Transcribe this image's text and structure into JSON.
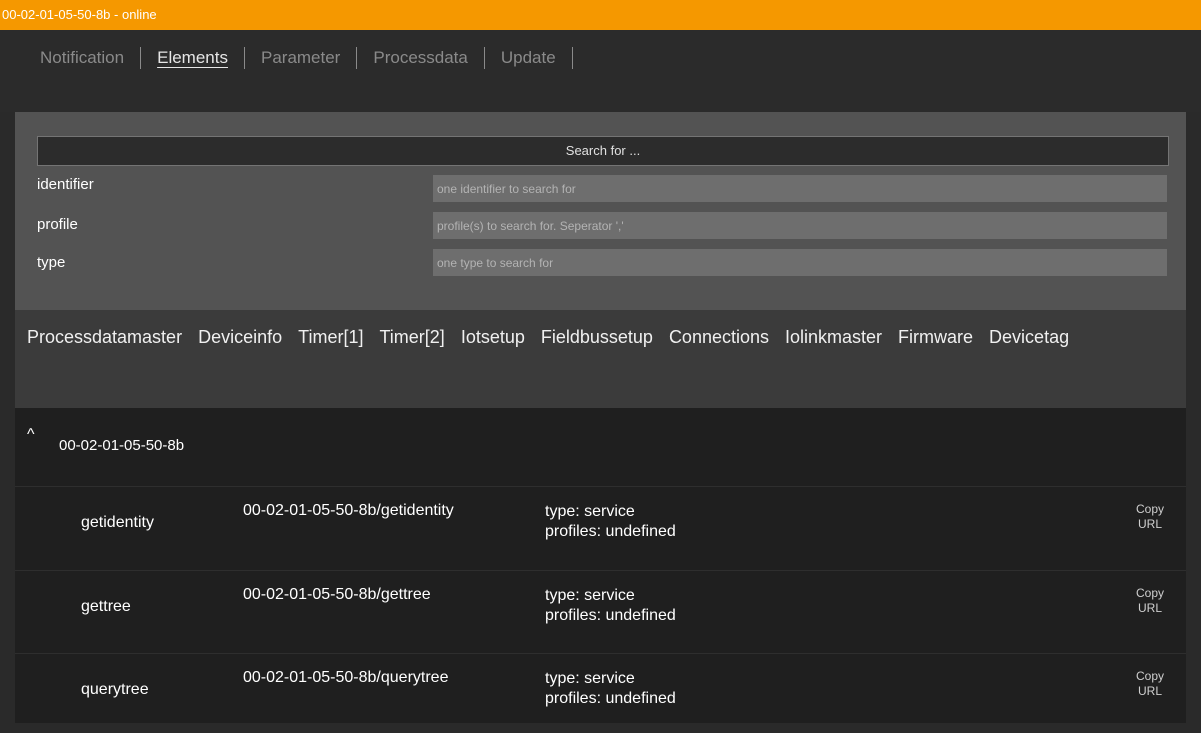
{
  "window": {
    "title": "00-02-01-05-50-8b - online"
  },
  "tabs": [
    {
      "label": "Notification"
    },
    {
      "label": "Elements"
    },
    {
      "label": "Parameter"
    },
    {
      "label": "Processdata"
    },
    {
      "label": "Update"
    }
  ],
  "active_tab": "Elements",
  "search": {
    "heading": "Search for ...",
    "fields": [
      {
        "label": "identifier",
        "placeholder": "one identifier to search for"
      },
      {
        "label": "profile",
        "placeholder": "profile(s) to search for. Seperator ','"
      },
      {
        "label": "type",
        "placeholder": "one type to search for"
      }
    ]
  },
  "categories": [
    "Processdatamaster",
    "Deviceinfo",
    "Timer[1]",
    "Timer[2]",
    "Iotsetup",
    "Fieldbussetup",
    "Connections",
    "Iolinkmaster",
    "Firmware",
    "Devicetag"
  ],
  "tree": {
    "caret": "^",
    "node": "00-02-01-05-50-8b",
    "rows": [
      {
        "name": "getidentity",
        "path": "00-02-01-05-50-8b/getidentity",
        "type": "type: service",
        "profiles": "profiles: undefined",
        "copy_line1": "Copy",
        "copy_line2": "URL"
      },
      {
        "name": "gettree",
        "path": "00-02-01-05-50-8b/gettree",
        "type": "type: service",
        "profiles": "profiles: undefined",
        "copy_line1": "Copy",
        "copy_line2": "URL"
      },
      {
        "name": "querytree",
        "path": "00-02-01-05-50-8b/querytree",
        "type": "type: service",
        "profiles": "profiles: undefined",
        "copy_line1": "Copy",
        "copy_line2": "URL"
      }
    ]
  },
  "colors": {
    "titlebar": "#f59800",
    "background": "#2a2a2a",
    "panel": "#535353",
    "category_bar": "#3b3b3b",
    "tree_bg": "#1f1f1f"
  }
}
